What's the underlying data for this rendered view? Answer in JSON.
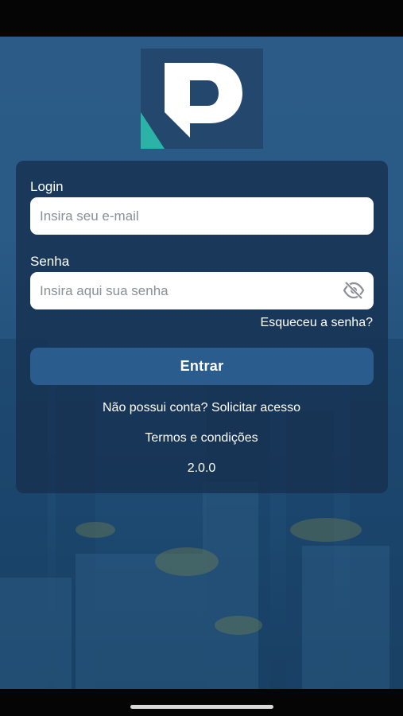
{
  "login_form": {
    "login_label": "Login",
    "login_placeholder": "Insira seu e-mail",
    "password_label": "Senha",
    "password_placeholder": "Insira aqui sua senha",
    "forgot_password": "Esqueceu a senha?",
    "submit_label": "Entrar",
    "request_access": "Não possui conta? Solicitar acesso",
    "terms": "Termos e condições",
    "version": "2.0.0"
  },
  "icons": {
    "logo": "app-logo",
    "password_toggle": "eye-slash-icon"
  },
  "colors": {
    "background": "#2a5a86",
    "card": "#16304e",
    "button": "#2a5d8d",
    "logo_bg": "#24476e",
    "logo_accent": "#2bb3a8"
  }
}
